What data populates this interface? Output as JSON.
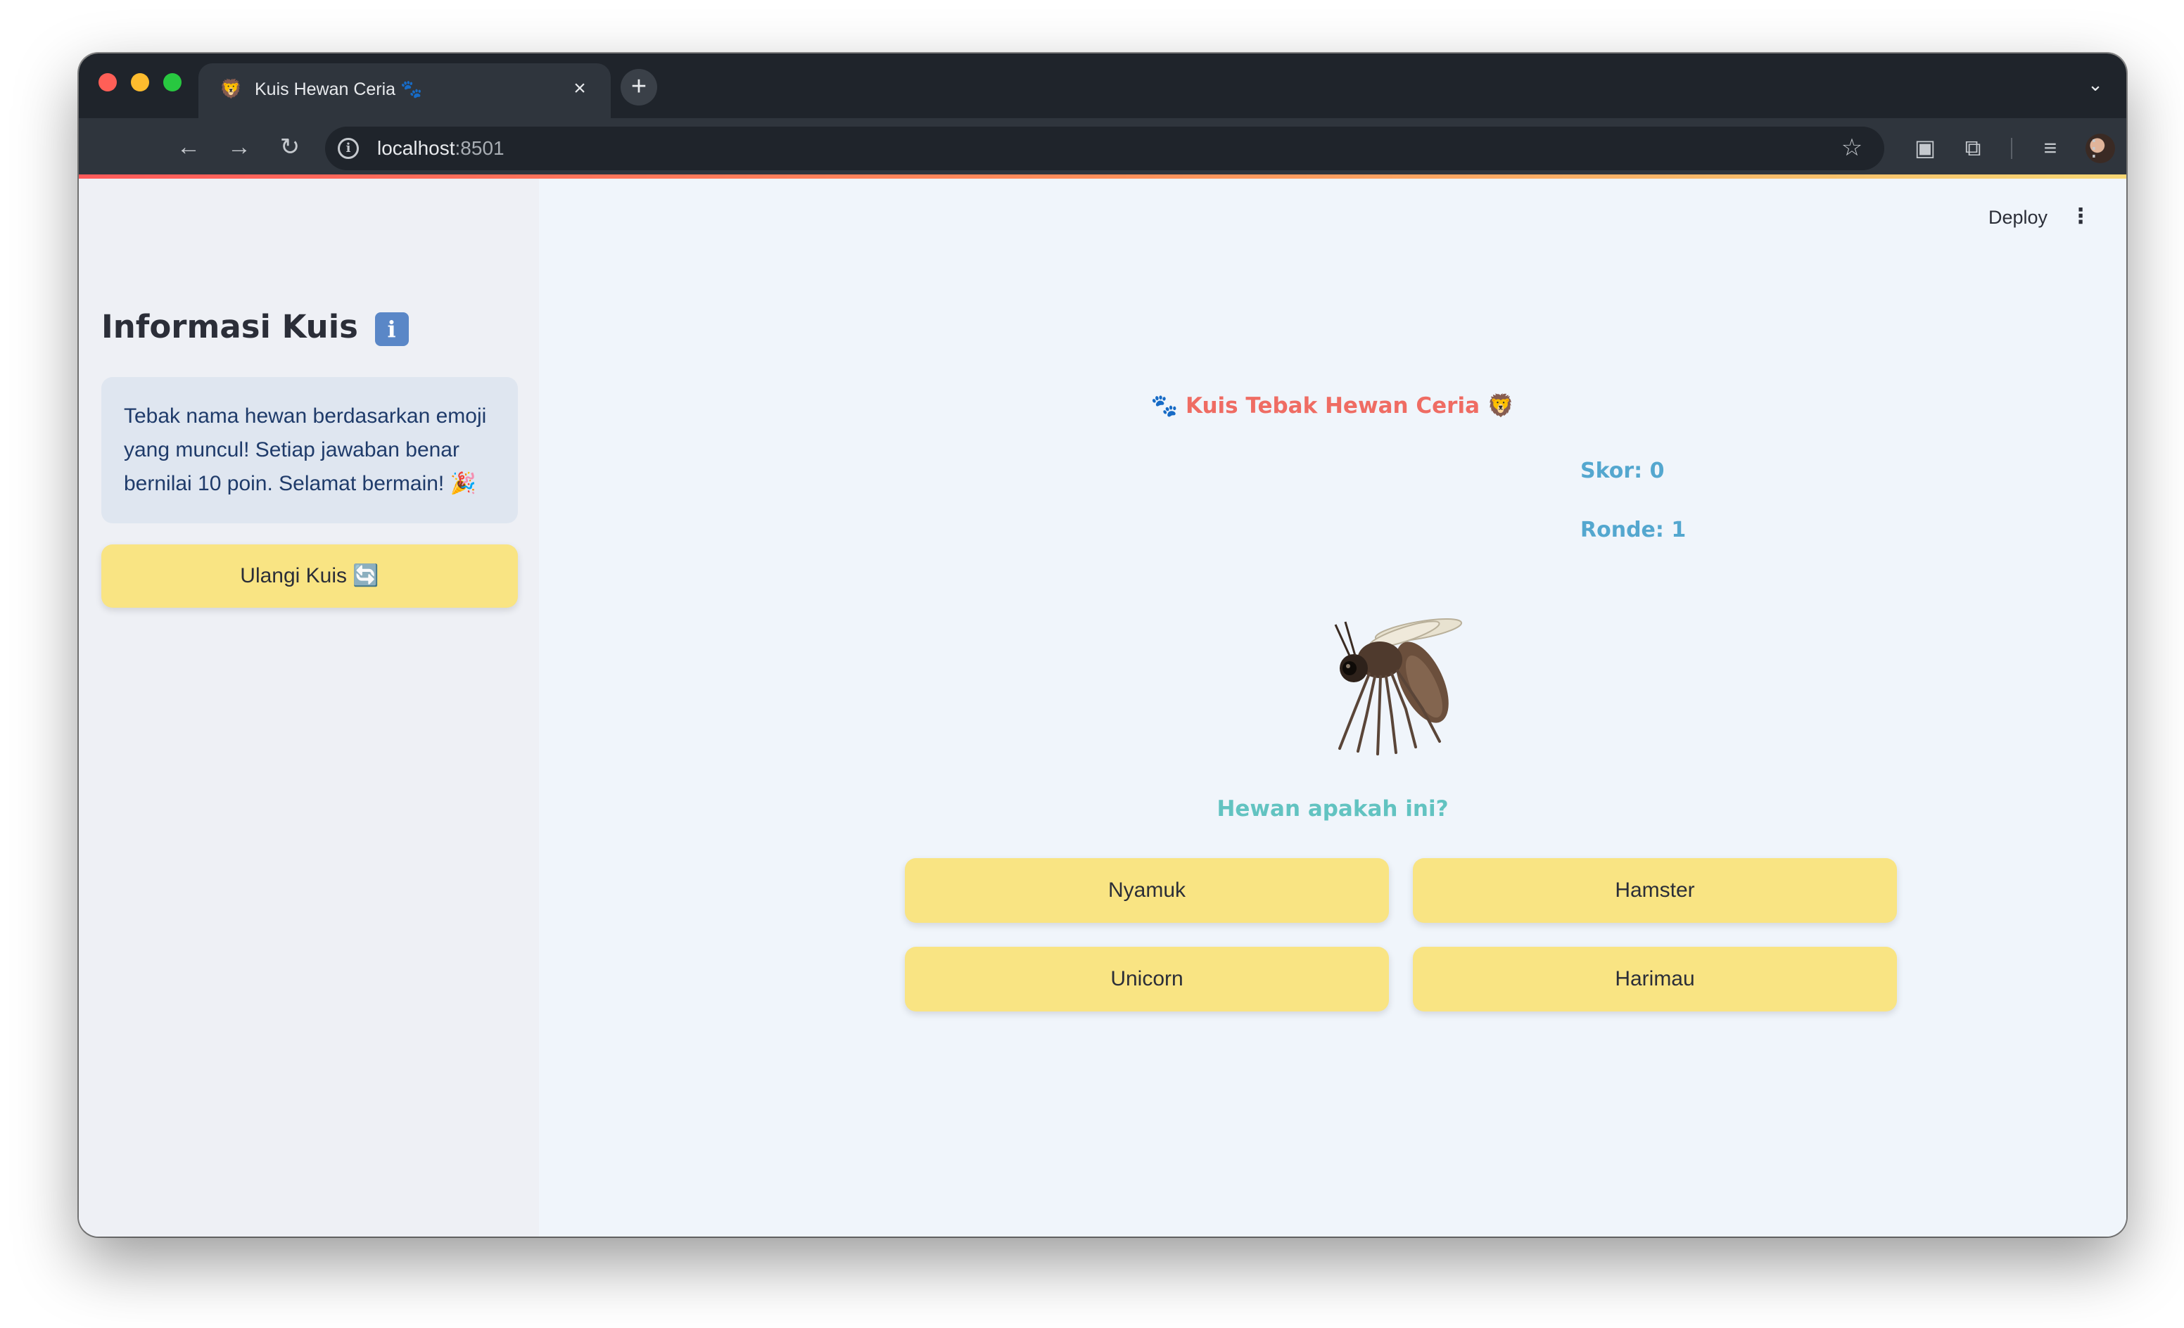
{
  "browser": {
    "tab_title": "Kuis Hewan Ceria 🐾",
    "tab_favicon": "🦁",
    "url_host": "localhost",
    "url_port": ":8501",
    "icons": [
      "back-arrow-icon",
      "forward-arrow-icon",
      "reload-icon",
      "site-info-icon",
      "bookmark-star-icon",
      "extension-icon",
      "puzzle-icon",
      "media-icon",
      "profile-avatar",
      "more-menu-icon"
    ]
  },
  "app": {
    "deploy_label": "Deploy",
    "kebab": "⋮"
  },
  "sidebar": {
    "title": "Informasi Kuis",
    "title_badge": "i",
    "info_text": "Tebak nama hewan berdasarkan emoji yang muncul! Setiap jawaban benar bernilai 10 poin. Selamat bermain! 🎉",
    "restart_label": "Ulangi Kuis 🔄"
  },
  "quiz": {
    "title_prefix": "🐾",
    "title": "Kuis Tebak Hewan Ceria",
    "title_suffix": "🦁",
    "score": "Skor: 0",
    "round": "Ronde: 1",
    "animal_emoji": "mosquito",
    "question": "Hewan apakah ini?",
    "options": [
      "Nyamuk",
      "Hamster",
      "Unicorn",
      "Harimau"
    ]
  },
  "colors": {
    "title": "#ef6c63",
    "score": "#54a7cf",
    "question": "#62c3c1",
    "button": "#f9e483",
    "info_box": "#dfe6f0"
  }
}
